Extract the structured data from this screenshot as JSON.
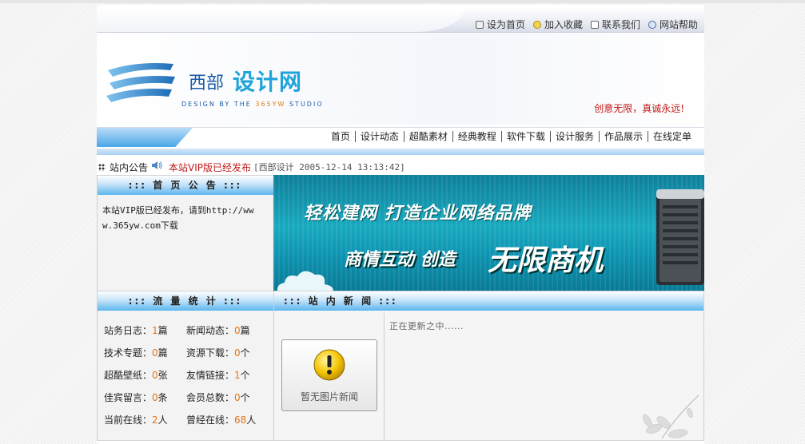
{
  "util_links": [
    {
      "label": "设为首页",
      "icon": "home-icon"
    },
    {
      "label": "加入收藏",
      "icon": "favorite-icon"
    },
    {
      "label": "联系我们",
      "icon": "contact-icon"
    },
    {
      "label": "网站帮助",
      "icon": "help-icon"
    }
  ],
  "logo": {
    "cn_part1": "西部",
    "cn_part2": "设计网",
    "en_prefix": "DESIGN BY THE ",
    "en_highlight": "365YW",
    "en_suffix": " STUDIO"
  },
  "slogan": "创意无限，真诚永远!",
  "nav": [
    "首页",
    "设计动态",
    "超酷素材",
    "经典教程",
    "软件下载",
    "设计服务",
    "作品展示",
    "在线定单"
  ],
  "announcement": {
    "label": "站内公告",
    "title": "本站VIP版已经发布",
    "meta": "[西部设计 2005-12-14 13:13:42]"
  },
  "notice": {
    "header": "::: 首 页 公 告 :::",
    "text": "本站VIP版已经发布，请到http://www.365yw.com下载"
  },
  "ad": {
    "line1": "轻松建网  打造企业网络品牌",
    "line2": "商情互动  创造",
    "line3": "无限商机"
  },
  "stats": {
    "header": "::: 流 量 统 计 :::",
    "items": [
      {
        "label": "站务日志：",
        "value": "1",
        "unit": "篇"
      },
      {
        "label": "新闻动态：",
        "value": "0",
        "unit": "篇"
      },
      {
        "label": "技术专题：",
        "value": "0",
        "unit": "篇"
      },
      {
        "label": "资源下载：",
        "value": "0",
        "unit": "个"
      },
      {
        "label": "超酷壁纸：",
        "value": "0",
        "unit": "张"
      },
      {
        "label": "友情链接：",
        "value": "1",
        "unit": "个"
      },
      {
        "label": "佳宾留言：",
        "value": "0",
        "unit": "条"
      },
      {
        "label": "会员总数：",
        "value": "0",
        "unit": "个"
      },
      {
        "label": "当前在线：",
        "value": "2",
        "unit": "人"
      },
      {
        "label": "曾经在线：",
        "value": "68",
        "unit": "人"
      }
    ]
  },
  "news": {
    "header": "::: 站 内 新 闻 :::",
    "thumb_label": "暂无图片新闻",
    "status": "正在更新之中......"
  },
  "colors": {
    "accent_blue": "#5cb6ef",
    "highlight_red": "#c01818",
    "value_orange": "#e27418"
  }
}
